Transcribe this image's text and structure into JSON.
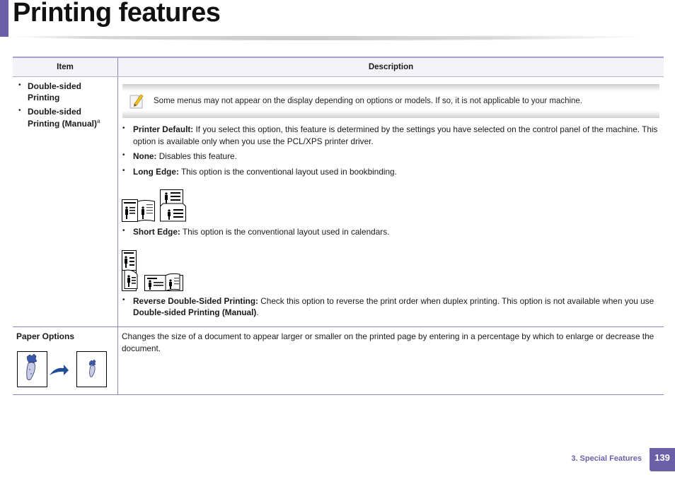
{
  "page": {
    "title": "Printing features",
    "accent_color": "#6b5fa8"
  },
  "table": {
    "headers": {
      "item": "Item",
      "description": "Description"
    },
    "rows": [
      {
        "items": [
          {
            "label": "Double-sided Printing",
            "sup": ""
          },
          {
            "label": "Double-sided Printing (Manual)",
            "sup": "a"
          }
        ],
        "note": {
          "icon": "note-pencil-icon",
          "text": "Some menus may not appear on the display depending on options or models. If so, it is not applicable to your machine."
        },
        "options": [
          {
            "term": "Printer Default:",
            "text": " If you select this option, this feature is determined by the settings you have selected on the control panel of the machine. This option is available only when you use the PCL/XPS printer driver."
          },
          {
            "term": "None:",
            "text": " Disables this feature."
          },
          {
            "term": "Long Edge:",
            "text": " This option is the conventional layout used in bookbinding."
          },
          {
            "term": "Short Edge:",
            "text": " This option is the conventional layout used in calendars."
          },
          {
            "term": "Reverse Double-Sided Printing:",
            "text": " Check this option to reverse the print order when duplex printing. This option is not available when you use ",
            "term2": "Double-sided Printing (Manual)",
            "tail": "."
          }
        ],
        "figures": {
          "long_edge": [
            "long-edge-landscape-book-icon",
            "long-edge-portrait-flip-icon"
          ],
          "short_edge": [
            "short-edge-portrait-flip-icon",
            "short-edge-landscape-book-icon"
          ]
        }
      },
      {
        "item": "Paper Options",
        "description": "Changes the size of a document to appear larger or smaller on the printed page by entering in a percentage by which to enlarge or decrease the document.",
        "figures": [
          "scale-original-page-icon",
          "scale-arrow-icon",
          "scale-reduced-page-icon"
        ]
      }
    ]
  },
  "footer": {
    "section": "3.  Special Features",
    "page_number": "139"
  }
}
